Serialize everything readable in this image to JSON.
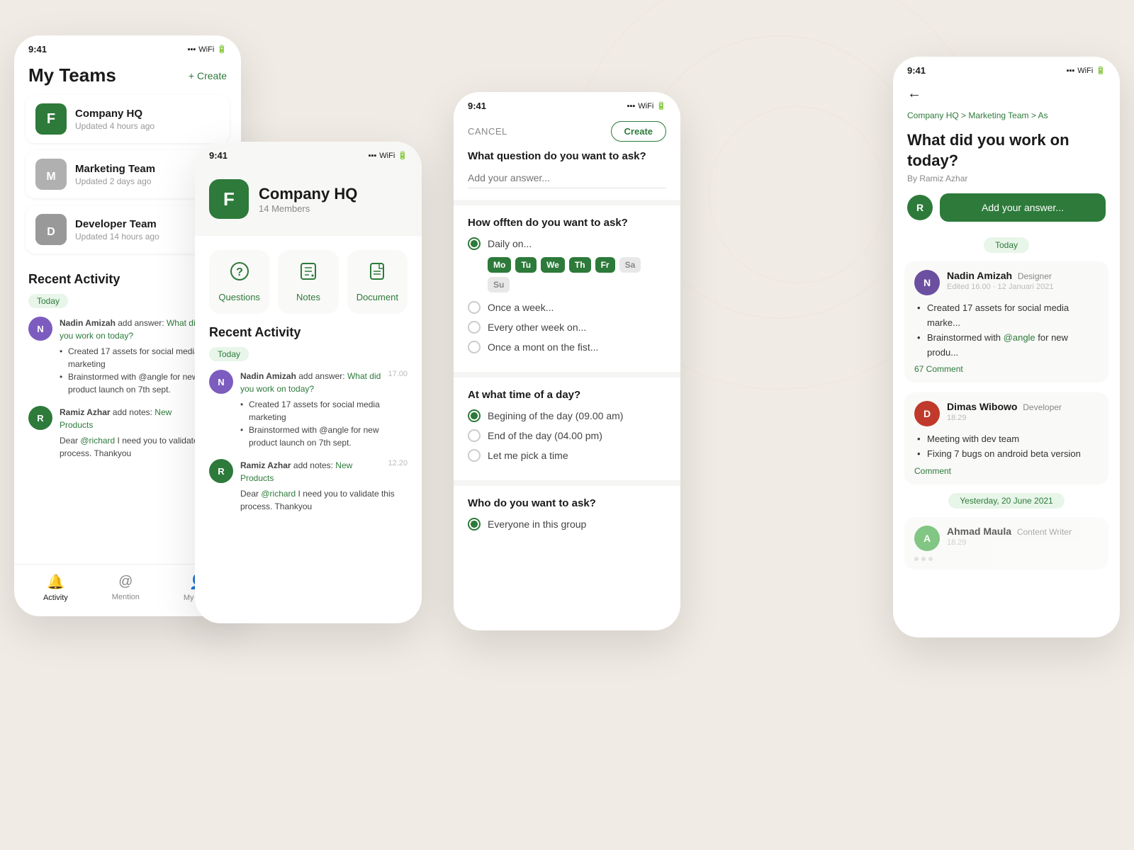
{
  "bg": {
    "color": "#f0ebe4"
  },
  "phone1": {
    "status_time": "9:41",
    "title": "My Teams",
    "create_btn": "+ Create",
    "teams": [
      {
        "name": "Company HQ",
        "updated": "Updated 4 hours ago",
        "initial": "F",
        "color": "green"
      },
      {
        "name": "Marketing Team",
        "updated": "Updated 2 days ago",
        "initial": "M",
        "color": "gray"
      },
      {
        "name": "Developer Team",
        "updated": "Updated 14 hours ago",
        "initial": "D",
        "color": "gray"
      }
    ],
    "recent_activity_title": "Recent Activity",
    "today_label": "Today",
    "activities": [
      {
        "initial": "N",
        "color": "av-purple",
        "name": "Nadin Amizah",
        "action": "add answer:",
        "highlight": "What did you work on today?",
        "time": "17.00",
        "bullets": [
          "Created 17 assets for social media marketing",
          "Brainstormed with @angle for new product launch on 7th sept."
        ]
      },
      {
        "initial": "R",
        "color": "av-green",
        "name": "Ramiz Azhar",
        "action": "add notes:",
        "highlight": "New Products",
        "time": "12.20",
        "body": "Dear @richard I need you to validate this process. Thankyou"
      }
    ],
    "nav": [
      {
        "label": "Activity",
        "icon": "bell",
        "active": true
      },
      {
        "label": "Mention",
        "icon": "at",
        "active": false
      },
      {
        "label": "My Stuff",
        "icon": "person",
        "active": false
      }
    ]
  },
  "phone2": {
    "status_time": "9:41",
    "company_name": "Company HQ",
    "members": "14 Members",
    "logo_letter": "F",
    "actions": [
      {
        "label": "Questions",
        "icon": "questions"
      },
      {
        "label": "Notes",
        "icon": "notes"
      },
      {
        "label": "Document",
        "icon": "document"
      }
    ],
    "recent_activity_title": "Recent Activity",
    "today_label": "Today",
    "activities": [
      {
        "initial": "N",
        "color": "av-purple",
        "name": "Nadin Amizah",
        "action": "add answer:",
        "highlight": "What did you work on today?",
        "time": "17.00",
        "bullets": [
          "Created 17 assets for social media marketing",
          "Brainstormed with @angle for new product launch on 7th sept."
        ]
      },
      {
        "initial": "R",
        "color": "av-green",
        "name": "Ramiz Azhar",
        "action": "add notes:",
        "highlight": "New Products",
        "time": "12.20",
        "body": "Dear @richard I need you to validate this process. Thankyou"
      }
    ]
  },
  "phone3": {
    "status_time": "9:41",
    "cancel_label": "CANCEL",
    "create_label": "Create",
    "question_label": "What question do you want to ask?",
    "question_placeholder": "Add your answer...",
    "frequency_label": "How offten do you want to ask?",
    "frequency_options": [
      {
        "label": "Daily on...",
        "selected": true
      },
      {
        "label": "Once a week...",
        "selected": false
      },
      {
        "label": "Every other week on...",
        "selected": false
      },
      {
        "label": "Once a mont on the fist...",
        "selected": false
      }
    ],
    "days": [
      {
        "label": "Mo",
        "active": true
      },
      {
        "label": "Tu",
        "active": true
      },
      {
        "label": "We",
        "active": true
      },
      {
        "label": "Th",
        "active": true
      },
      {
        "label": "Fr",
        "active": true
      },
      {
        "label": "Sa",
        "active": false
      },
      {
        "label": "Su",
        "active": false
      }
    ],
    "time_label": "At what time of a day?",
    "time_options": [
      {
        "label": "Begining of the day (09.00 am)",
        "selected": true
      },
      {
        "label": "End of the day (04.00 pm)",
        "selected": false
      },
      {
        "label": "Let me pick a time",
        "selected": false
      }
    ],
    "who_label": "Who do you want to ask?",
    "who_options": [
      {
        "label": "Everyone in this group",
        "selected": true
      }
    ]
  },
  "phone4": {
    "status_time": "9:41",
    "back_icon": "←",
    "breadcrumb": "Company HQ > Marketing Team > As",
    "question_title": "What did you work on today?",
    "by_line": "By Ramiz Azhar",
    "add_answer_label": "Add your answer...",
    "user_initial": "R",
    "today_label": "Today",
    "activities": [
      {
        "initial": "N",
        "color": "av-dark-purple",
        "name": "Nadin Amizah",
        "role": "Designer",
        "edited": "Edited 16.00 · 12 Januari 2021",
        "bullets": [
          "Created 17 assets for social media marke...",
          "Brainstormed with @angle for new produ..."
        ],
        "comment_link": "67 Comment"
      },
      {
        "initial": "D",
        "color": "av-red",
        "name": "Dimas Wibowo",
        "role": "Developer",
        "time": "18.29",
        "bullets": [
          "Meeting with dev team",
          "Fixing 7 bugs on android beta version"
        ],
        "comment_link": "Comment"
      }
    ],
    "yesterday_label": "Yesterday, 20 June 2021",
    "yesterday_activities": [
      {
        "initial": "A",
        "color": "av-light-green",
        "name": "Ahmad Maula",
        "role": "Content Writer",
        "time": "18.29"
      }
    ]
  }
}
